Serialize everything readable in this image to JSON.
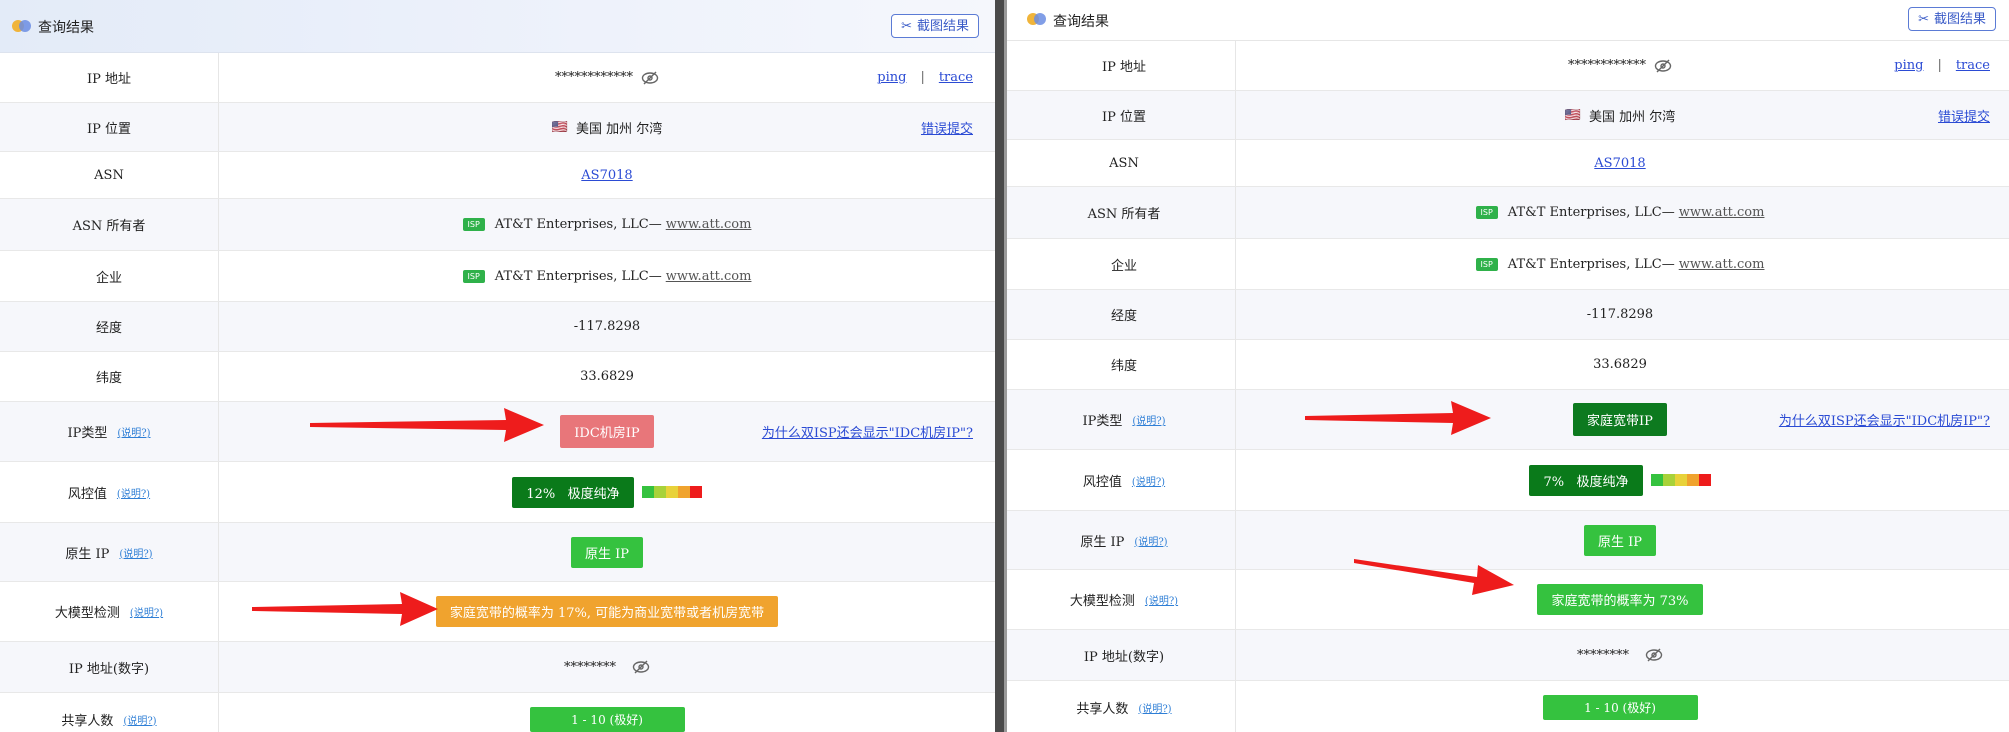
{
  "header": {
    "title": "查询结果",
    "screenshot_label": "截图结果"
  },
  "rows": {
    "ip_address": {
      "label": "IP 地址",
      "value": "************",
      "ping": "ping",
      "sep": "|",
      "trace": "trace"
    },
    "ip_location": {
      "label": "IP 位置",
      "flag": "🇺🇸",
      "value": "美国 加州 尔湾",
      "report": "错误提交"
    },
    "asn": {
      "label": "ASN",
      "value": "AS7018"
    },
    "asn_owner": {
      "label": "ASN 所有者",
      "badge": "ISP",
      "name": "AT&T Enterprises, LLC—",
      "site": "www.att.com"
    },
    "enterprise": {
      "label": "企业",
      "badge": "ISP",
      "name": "AT&T Enterprises, LLC—",
      "site": "www.att.com"
    },
    "longitude": {
      "label": "经度",
      "value": "-117.8298"
    },
    "latitude": {
      "label": "纬度",
      "value": "33.6829"
    },
    "ip_type": {
      "label": "IP类型",
      "help": "(说明?)",
      "question": "为什么双ISP还会显示\"IDC机房IP\"?"
    },
    "risk": {
      "label": "风控值",
      "help": "(说明?)",
      "status": "极度纯净"
    },
    "native_ip": {
      "label": "原生 IP",
      "help": "(说明?)",
      "value": "原生 IP"
    },
    "llm_detect": {
      "label": "大模型检测",
      "help": "(说明?)"
    },
    "ip_numeric": {
      "label": "IP 地址(数字)",
      "value": "********"
    },
    "shared_users": {
      "label": "共享人数",
      "help": "(说明?)",
      "value": "1 - 10 (极好)"
    }
  },
  "left": {
    "ip_type_value": "IDC机房IP",
    "risk_percent": "12%",
    "llm_result": "家庭宽带的概率为 17%, 可能为商业宽带或者机房宽带"
  },
  "right": {
    "ip_type_value": "家庭宽带IP",
    "risk_percent": "7%",
    "llm_result": "家庭宽带的概率为 73%"
  },
  "colors": {
    "idc_pill": "#e8767a",
    "home_pill": "#0d7a1f",
    "risk_pill": "#0a7a1a",
    "native_pill": "#35c23f",
    "llm_orange": "#f0a32e",
    "llm_green": "#35c23f",
    "shared_pill": "#35c23f",
    "arrow": "#ee1c1c",
    "risk_bar": [
      "#35c23f",
      "#a8d23a",
      "#e8d23a",
      "#f0a32e",
      "#ee1c1c"
    ]
  },
  "icons": {
    "logo": "two-circles-logo",
    "screenshot": "scissors-icon",
    "eye": "eye-off-icon",
    "arrow": "red-arrow"
  }
}
